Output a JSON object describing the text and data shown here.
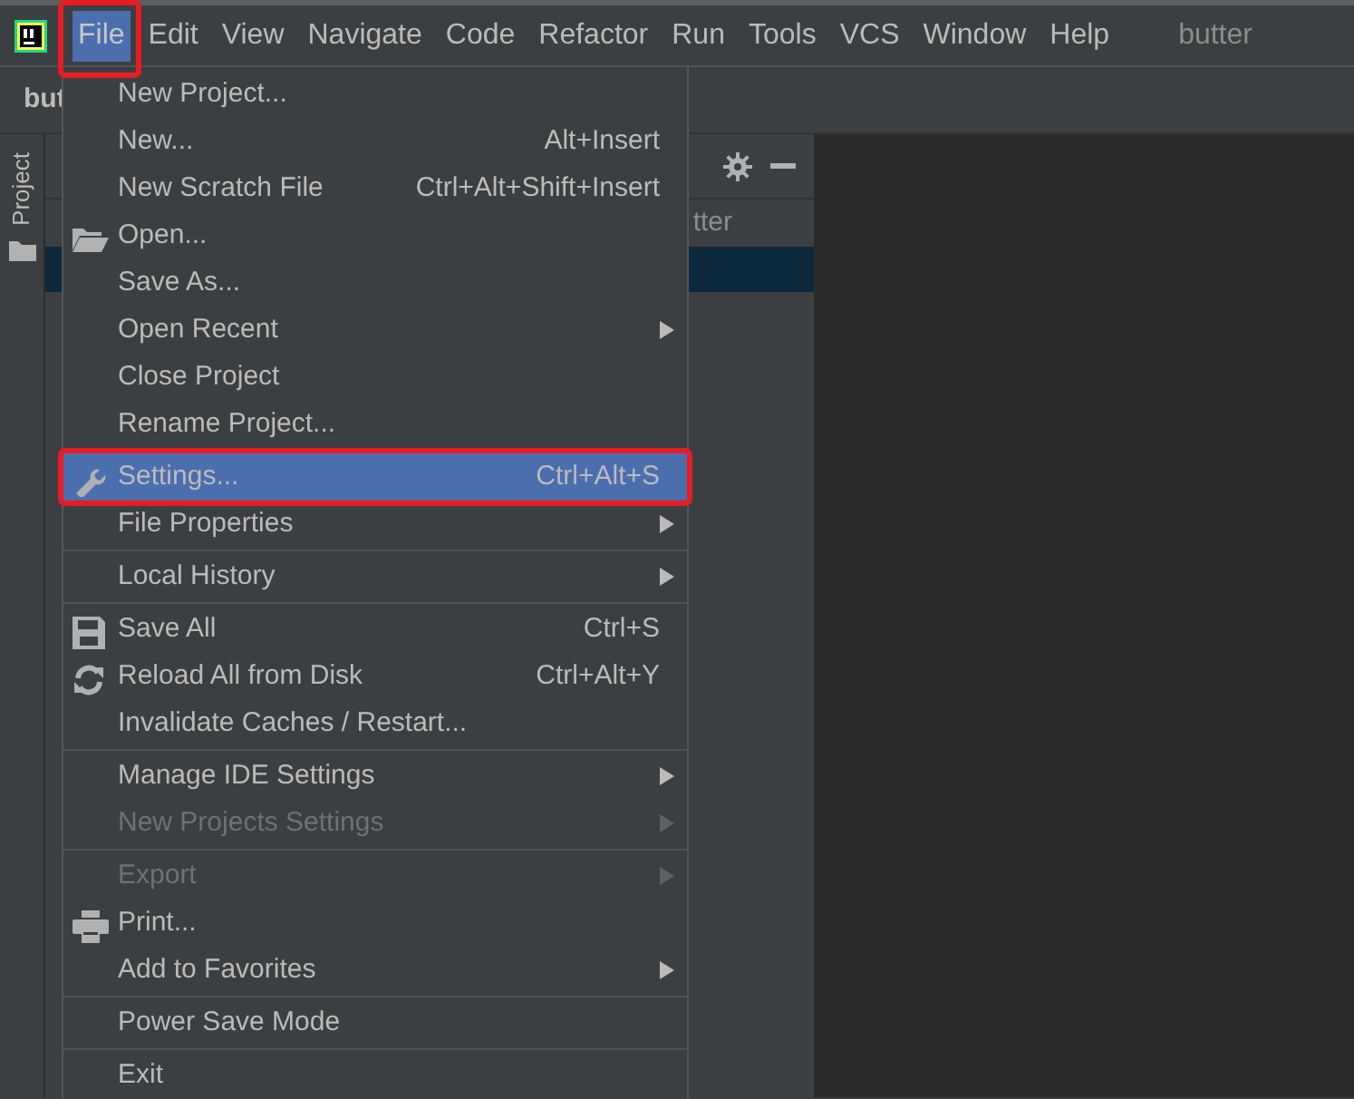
{
  "menubar": [
    {
      "label": "File",
      "selected": true
    },
    {
      "label": "Edit",
      "selected": false
    },
    {
      "label": "View",
      "selected": false
    },
    {
      "label": "Navigate",
      "selected": false
    },
    {
      "label": "Code",
      "selected": false
    },
    {
      "label": "Refactor",
      "selected": false
    },
    {
      "label": "Run",
      "selected": false
    },
    {
      "label": "Tools",
      "selected": false
    },
    {
      "label": "VCS",
      "selected": false
    },
    {
      "label": "Window",
      "selected": false
    },
    {
      "label": "Help",
      "selected": false
    }
  ],
  "window": {
    "title": "butter"
  },
  "navbar": {
    "crumb": "but"
  },
  "tool_window": {
    "tab": "Project",
    "visible_root": "tter"
  },
  "file_menu": [
    {
      "kind": "item",
      "label": "New Project...",
      "selected": false,
      "disabled": false,
      "submenu": false
    },
    {
      "kind": "item",
      "label": "New...",
      "shortcut": "Alt+Insert",
      "selected": false,
      "disabled": false,
      "submenu": false
    },
    {
      "kind": "item",
      "label": "New Scratch File",
      "shortcut": "Ctrl+Alt+Shift+Insert",
      "selected": false,
      "disabled": false,
      "submenu": false
    },
    {
      "kind": "folder",
      "label": "Open...",
      "selected": false,
      "disabled": false,
      "submenu": false
    },
    {
      "kind": "item",
      "label": "Save As...",
      "selected": false,
      "disabled": false,
      "submenu": false
    },
    {
      "kind": "item",
      "label": "Open Recent",
      "selected": false,
      "disabled": false,
      "submenu": true
    },
    {
      "kind": "item",
      "label": "Close Project",
      "selected": false,
      "disabled": false,
      "submenu": false
    },
    {
      "kind": "item",
      "label": "Rename Project...",
      "selected": false,
      "disabled": false,
      "submenu": false
    },
    {
      "kind": "separator"
    },
    {
      "kind": "wrench",
      "label": "Settings...",
      "shortcut": "Ctrl+Alt+S",
      "selected": true,
      "disabled": false,
      "submenu": false
    },
    {
      "kind": "item",
      "label": "File Properties",
      "selected": false,
      "disabled": false,
      "submenu": true
    },
    {
      "kind": "separator"
    },
    {
      "kind": "item",
      "label": "Local History",
      "selected": false,
      "disabled": false,
      "submenu": true
    },
    {
      "kind": "separator"
    },
    {
      "kind": "save",
      "label": "Save All",
      "shortcut": "Ctrl+S",
      "selected": false,
      "disabled": false,
      "submenu": false
    },
    {
      "kind": "reload",
      "label": "Reload All from Disk",
      "shortcut": "Ctrl+Alt+Y",
      "selected": false,
      "disabled": false,
      "submenu": false
    },
    {
      "kind": "item",
      "label": "Invalidate Caches / Restart...",
      "selected": false,
      "disabled": false,
      "submenu": false
    },
    {
      "kind": "separator"
    },
    {
      "kind": "item",
      "label": "Manage IDE Settings",
      "selected": false,
      "disabled": false,
      "submenu": true
    },
    {
      "kind": "item",
      "label": "New Projects Settings",
      "selected": false,
      "disabled": true,
      "submenu": true
    },
    {
      "kind": "separator"
    },
    {
      "kind": "item",
      "label": "Export",
      "selected": false,
      "disabled": true,
      "submenu": true
    },
    {
      "kind": "print",
      "label": "Print...",
      "selected": false,
      "disabled": false,
      "submenu": false
    },
    {
      "kind": "item",
      "label": "Add to Favorites",
      "selected": false,
      "disabled": false,
      "submenu": true
    },
    {
      "kind": "separator"
    },
    {
      "kind": "item",
      "label": "Power Save Mode",
      "selected": false,
      "disabled": false,
      "submenu": false
    },
    {
      "kind": "separator"
    },
    {
      "kind": "item",
      "label": "Exit",
      "selected": false,
      "disabled": false,
      "submenu": false
    }
  ]
}
